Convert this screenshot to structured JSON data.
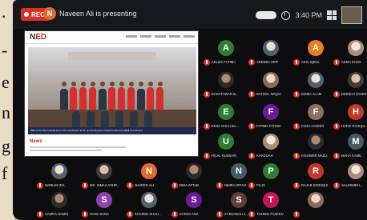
{
  "page_edge": {
    "glyphs": [
      ".",
      "-",
      "e",
      "n",
      "g",
      "f"
    ]
  },
  "topbar": {
    "rec_label": "REC",
    "presenter_initial": "N",
    "presenter_text": "Naveen Ali is presenting",
    "time": "3:40 PM",
    "colors": {
      "rec": "#d93025",
      "presenter_avatar": "#e06b32"
    }
  },
  "shared_screen": {
    "logo_prefix": "N",
    "logo_highlight": "ED",
    "caption": "NED University football team with coordinator Sir M. announcing the Karachi-Lahore Football Tournament",
    "section_label": "News"
  },
  "participants": [
    {
      "name": "Aeliza Fatima",
      "initial": "A",
      "color": "#2e7d32",
      "photo": false
    },
    {
      "name": "Areeba Arif",
      "initial": "",
      "color": "",
      "photo": true
    },
    {
      "name": "Asia Iqbal",
      "initial": "A",
      "color": "#e67e22",
      "photo": false
    },
    {
      "name": "Asma Khan",
      "initial": "",
      "color": "",
      "photo": true
    },
    {
      "name": "Bakhtawar B...",
      "initial": "",
      "color": "",
      "photo": true
    },
    {
      "name": "Batool Naqvi",
      "initial": "",
      "color": "",
      "photo": true
    },
    {
      "name": "Bisma Alam",
      "initial": "",
      "color": "",
      "photo": true
    },
    {
      "name": "Debsha Javed",
      "initial": "",
      "color": "",
      "photo": true
    },
    {
      "name": "Eesa Shah Ba...",
      "initial": "E",
      "color": "#2e7d32",
      "photo": false
    },
    {
      "name": "Fatima Fatima",
      "initial": "F",
      "color": "#6a1b9a",
      "photo": false
    },
    {
      "name": "Fizza Haider",
      "initial": "F",
      "color": "#8d6e63",
      "photo": false
    },
    {
      "name": "Hafiz Rahiqu...",
      "initial": "H",
      "color": "#c0392b",
      "photo": false
    },
    {
      "name": "Hilal Hussain",
      "initial": "U",
      "color": "#2e7d32",
      "photo": false
    },
    {
      "name": "Khadijah",
      "initial": "",
      "color": "",
      "photo": true
    },
    {
      "name": "Kishwer Nazli",
      "initial": "",
      "color": "",
      "photo": true
    },
    {
      "name": "Maha Kamil",
      "initial": "M",
      "color": "#455a64",
      "photo": false
    },
    {
      "name": "Mariam Zia",
      "initial": "",
      "color": "",
      "photo": true
    },
    {
      "name": "Ms. Ismaa Ashr...",
      "initial": "",
      "color": "",
      "photo": true
    },
    {
      "name": "Naveen Ali",
      "initial": "N",
      "color": "#e06b32",
      "photo": false
    },
    {
      "name": "Nida Aftab",
      "initial": "",
      "color": "",
      "photo": true
    },
    {
      "name": "Nimra Irfan",
      "initial": "N",
      "color": "#455a64",
      "photo": false
    },
    {
      "name": "Plus",
      "initial": "P",
      "color": "#2e7d32",
      "photo": false
    },
    {
      "name": "Rajab Siddiqui",
      "initial": "R",
      "color": "#c0392b",
      "photo": false
    },
    {
      "name": "Saleemeh...",
      "initial": "",
      "color": "",
      "photo": true
    },
    {
      "name": "Samra Hamid",
      "initial": "",
      "color": "",
      "photo": true
    },
    {
      "name": "Sana Sana",
      "initial": "S",
      "color": "#8e44ad",
      "photo": false
    },
    {
      "name": "Shazma Shah...",
      "initial": "",
      "color": "",
      "photo": true
    },
    {
      "name": "Syeda Ana",
      "initial": "S",
      "color": "#6a1b9a",
      "photo": false
    },
    {
      "name": "Syedabah J...",
      "initial": "S",
      "color": "#5d4037",
      "photo": false
    },
    {
      "name": "Tazeen Fazeen",
      "initial": "T",
      "color": "#c2185b",
      "photo": false
    },
    {
      "name": "",
      "initial": "",
      "color": "",
      "photo": true
    }
  ]
}
